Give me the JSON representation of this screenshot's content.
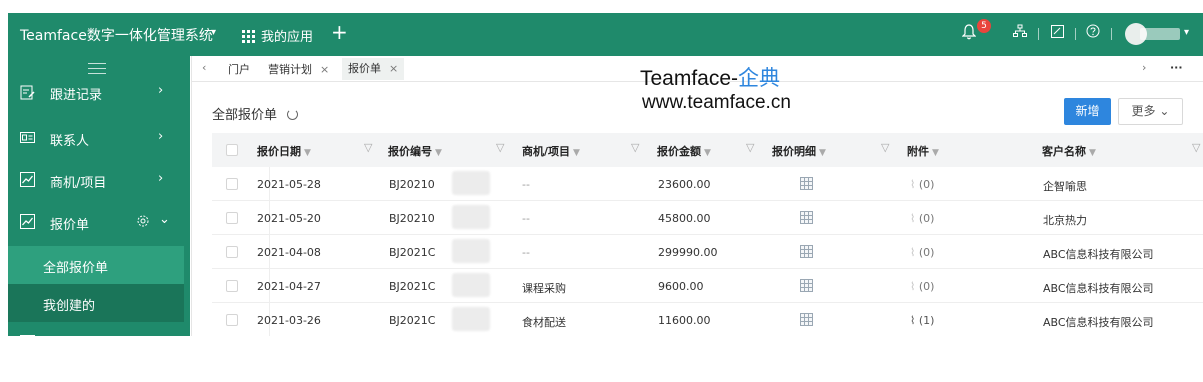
{
  "topbar": {
    "brand": "Teamface数字一体化管理系统",
    "apps_label": "我的应用",
    "notification_count": "5"
  },
  "sidebar": {
    "items": [
      {
        "label": "跟进记录"
      },
      {
        "label": "联系人"
      },
      {
        "label": "商机/项目"
      },
      {
        "label": "报价单"
      }
    ],
    "sub_items": [
      {
        "label": "全部报价单",
        "active": true
      },
      {
        "label": "我创建的",
        "active": false
      }
    ]
  },
  "tabs": [
    {
      "label": "门户"
    },
    {
      "label": "营销计划"
    },
    {
      "label": "报价单"
    }
  ],
  "watermark": {
    "line1_prefix": "Teamface-",
    "line1_suffix": "企典",
    "line2": "www.teamface.cn"
  },
  "page": {
    "title": "全部报价单",
    "add_button": "新增",
    "more_button": "更多"
  },
  "table": {
    "columns": [
      "报价日期",
      "报价编号",
      "商机/项目",
      "报价金额",
      "报价明细",
      "附件",
      "客户名称"
    ],
    "rows": [
      {
        "date": "2021-05-28",
        "code": "BJ20210",
        "project": "--",
        "amount": "23600.00",
        "attachments": "(0)",
        "customer": "企智喻思"
      },
      {
        "date": "2021-05-20",
        "code": "BJ20210",
        "project": "--",
        "amount": "45800.00",
        "attachments": "(0)",
        "customer": "北京热力"
      },
      {
        "date": "2021-04-08",
        "code": "BJ2021C",
        "project": "--",
        "amount": "299990.00",
        "attachments": "(0)",
        "customer": "ABC信息科技有限公司"
      },
      {
        "date": "2021-04-27",
        "code": "BJ2021C",
        "project": "课程采购",
        "amount": "9600.00",
        "attachments": "(0)",
        "customer": "ABC信息科技有限公司"
      },
      {
        "date": "2021-03-26",
        "code": "BJ2021C",
        "project": "食材配送",
        "amount": "11600.00",
        "attachments": "(1)",
        "customer": "ABC信息科技有限公司"
      }
    ]
  },
  "colors": {
    "primary_green": "#1f8a6b",
    "accent_blue": "#2e86de"
  }
}
